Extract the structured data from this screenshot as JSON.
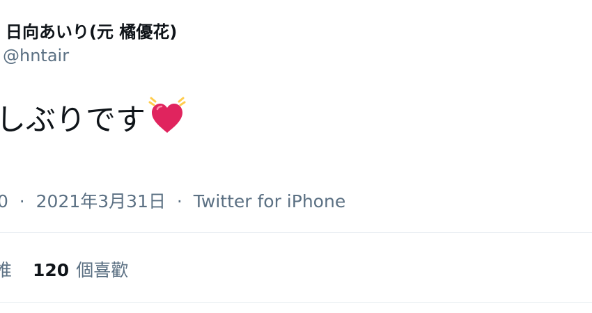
{
  "author": {
    "display_name": "日向あいり(元 橘優花)",
    "handle": "@hntair"
  },
  "tweet": {
    "text": "しぶりです",
    "emoji": "beating-heart-icon"
  },
  "meta": {
    "time_fragment": "0",
    "separator": "·",
    "date": "2021年3月31日",
    "source": "Twitter for iPhone"
  },
  "stats": {
    "retweets_label_fragment": "推",
    "likes_count": "120",
    "likes_label": "個喜歡"
  },
  "colors": {
    "primary_text": "#0f1419",
    "secondary_text": "#5b7083",
    "divider": "#e6ecf0",
    "heart": "#e0245e",
    "heart_glow": "#ffcc4d"
  }
}
